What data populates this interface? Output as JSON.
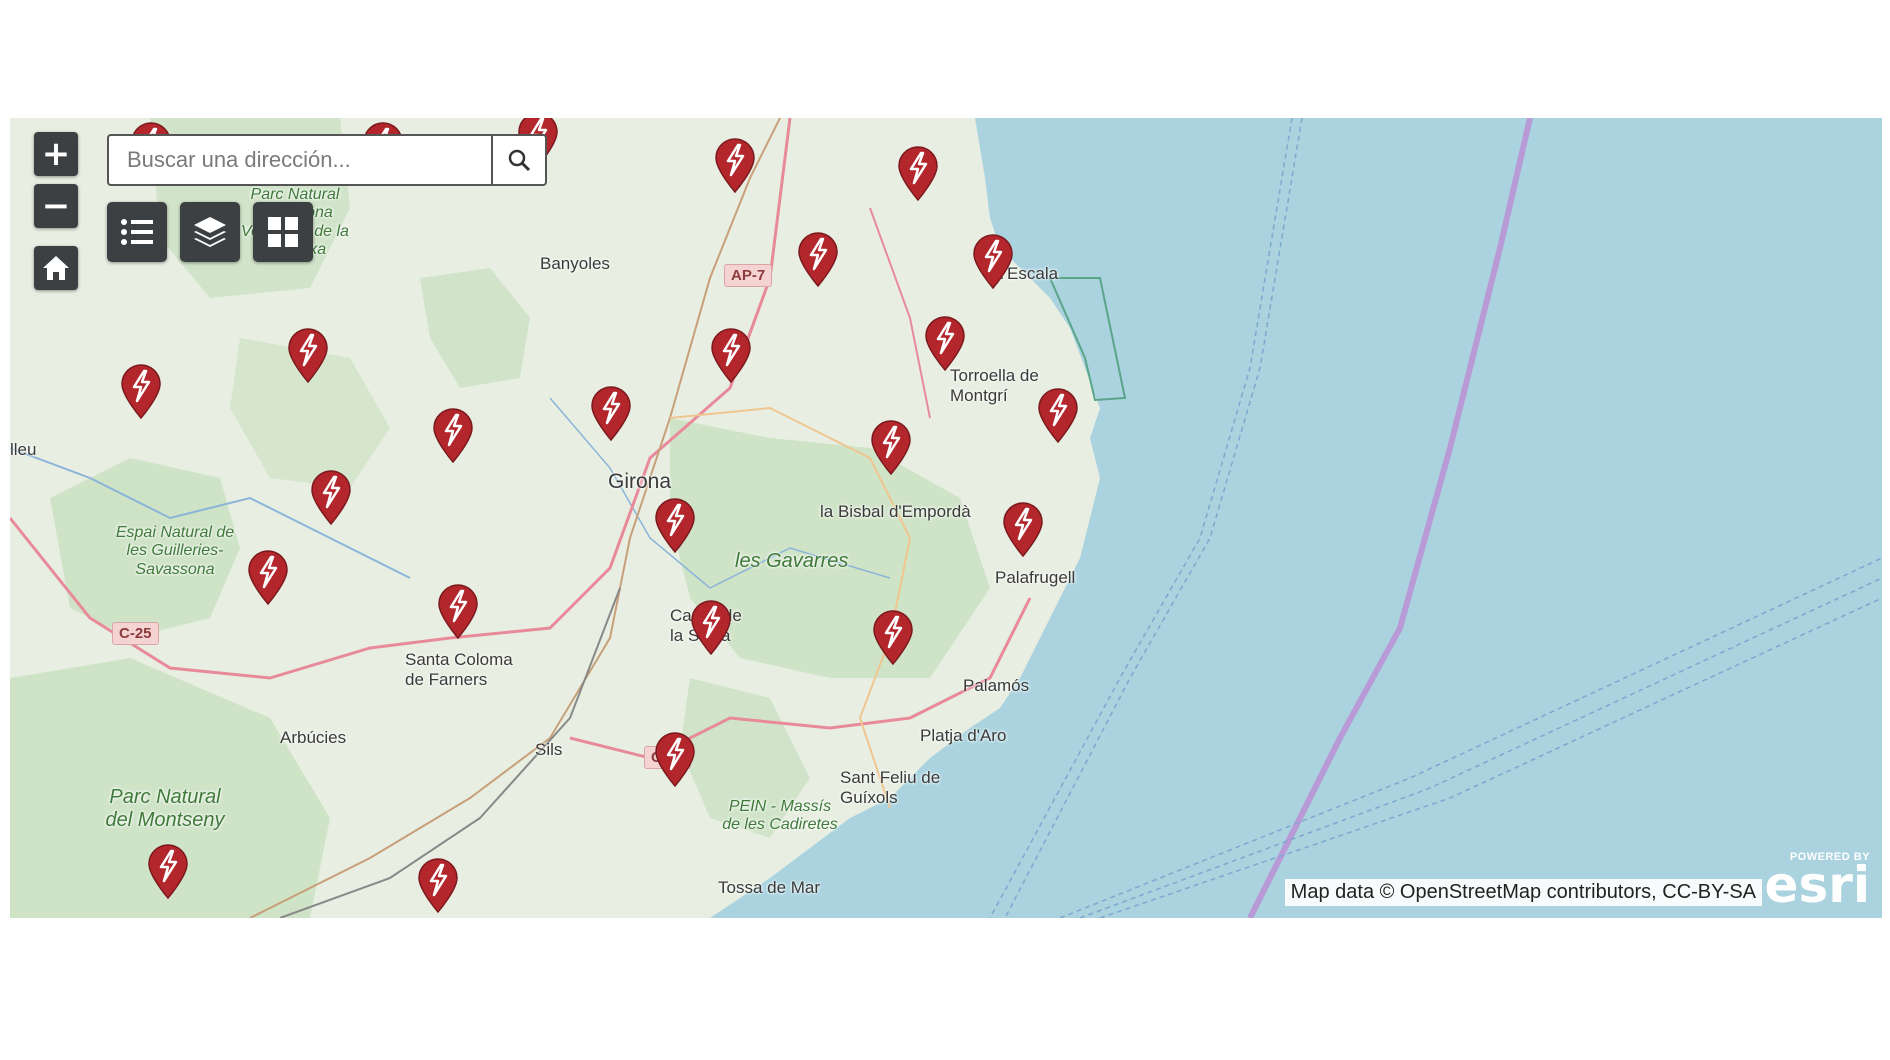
{
  "search": {
    "placeholder": "Buscar una dirección..."
  },
  "controls": {
    "zoom_in_label": "+",
    "zoom_out_label": "−"
  },
  "icons": {
    "zoom_in": "plus-icon",
    "zoom_out": "minus-icon",
    "home": "home-icon",
    "search": "search-icon",
    "list": "list-icon",
    "layers": "layers-icon",
    "basemap": "grid-icon",
    "marker": "lightning-marker-icon"
  },
  "colors": {
    "marker": "#b3262c",
    "water": "#aad3df",
    "land": "#e8efe2",
    "park": "#c8e0c0",
    "controls": "#3c4043"
  },
  "places": [
    {
      "name": "Banyoles"
    },
    {
      "name": "Girona"
    },
    {
      "name": "la Bisbal d'Empordà"
    },
    {
      "name": "les Gavarres"
    },
    {
      "name": "Palafrugell"
    },
    {
      "name": "Palamós"
    },
    {
      "name": "Sant Feliu de Guíxols"
    },
    {
      "name": "Tossa de Mar"
    },
    {
      "name": "Santa Coloma de Farners"
    },
    {
      "name": "Arbúcies"
    },
    {
      "name": "Sils"
    },
    {
      "name": "Cassà de la Selva"
    },
    {
      "name": "Torroella de Montgrí"
    },
    {
      "name": "l'Escala"
    },
    {
      "name": "Platja d'Aro"
    },
    {
      "name": "Espai Natural de les Guilleries-Savassona"
    },
    {
      "name": "Parc Natural del Montseny"
    },
    {
      "name": "Parc Natural de la Zona Volcànica de la Garrotxa"
    },
    {
      "name": "PEIN - Massís de les Cadiretes"
    },
    {
      "name": "lleu"
    }
  ],
  "roads": [
    "AP-7",
    "C-25",
    "C-35"
  ],
  "markers_count": 24,
  "attribution": "Map data © OpenStreetMap contributors, CC-BY-SA",
  "esri": {
    "powered": "POWERED BY",
    "name": "esri"
  }
}
